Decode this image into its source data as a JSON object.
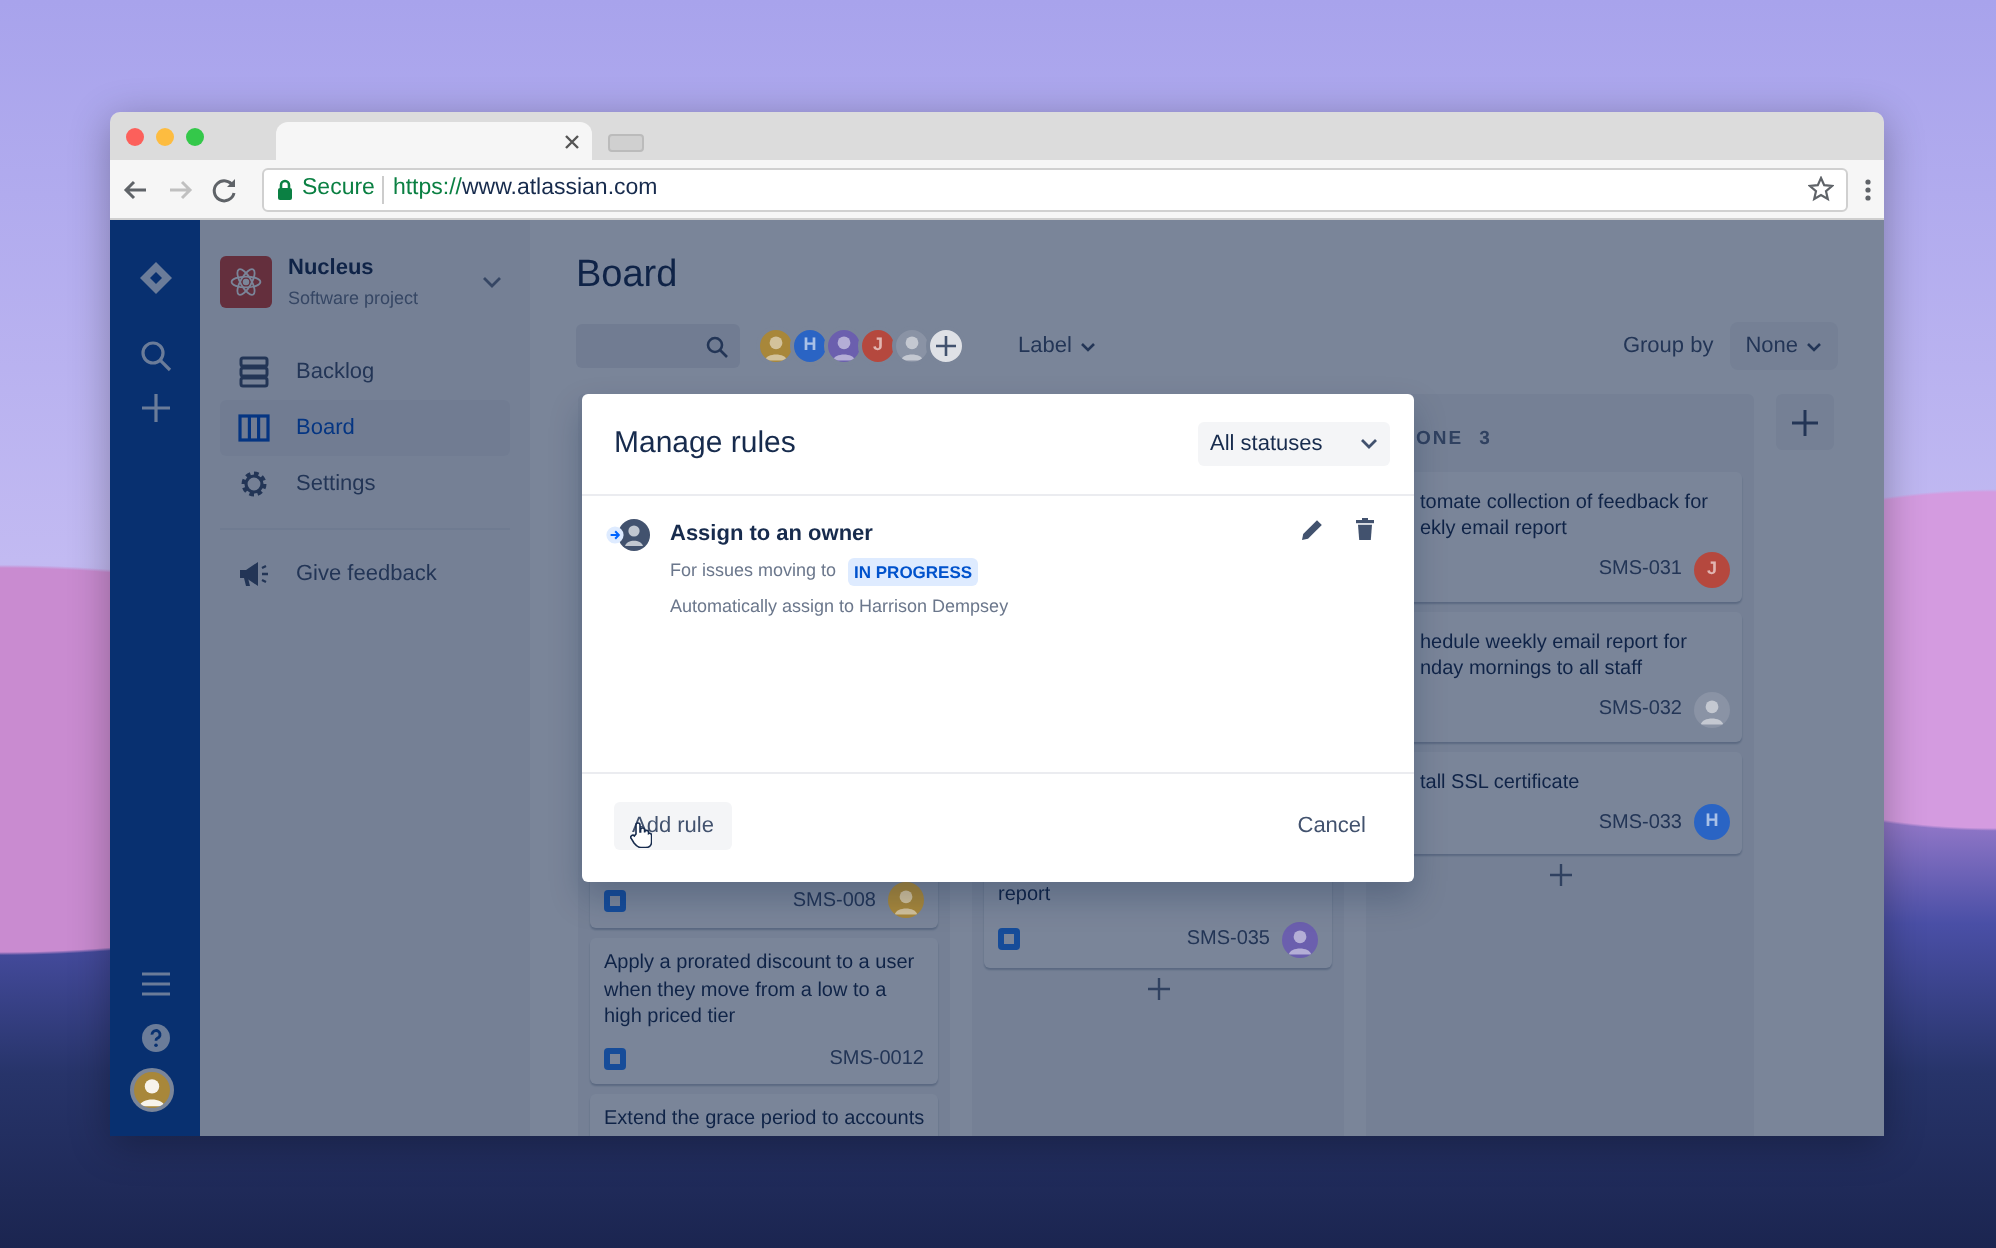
{
  "browser": {
    "back_disabled": false,
    "forward_disabled": true,
    "address": {
      "secure": "Secure",
      "scheme": "https://",
      "host": "www.atlassian.com"
    }
  },
  "project": {
    "name": "Nucleus",
    "type": "Software project"
  },
  "sidebar": {
    "items": [
      {
        "kind": "backlog",
        "label": "Backlog",
        "selected": false
      },
      {
        "kind": "board",
        "label": "Board",
        "selected": true
      },
      {
        "kind": "settings",
        "label": "Settings",
        "selected": false
      }
    ],
    "feedback": "Give feedback"
  },
  "board": {
    "title": "Board",
    "assignees": [
      {
        "kind": "photo",
        "color": "#a8873a"
      },
      {
        "kind": "initial",
        "initial": "H",
        "color": "#2a64c4"
      },
      {
        "kind": "photo",
        "color": "#6b5fae"
      },
      {
        "kind": "initial",
        "initial": "J",
        "color": "#b5483e"
      },
      {
        "kind": "photo",
        "color": "#8a93a5"
      }
    ],
    "label_filter": "Label",
    "group_by": {
      "label": "Group by",
      "value": "None"
    }
  },
  "columns": [
    {
      "cards": [
        {
          "issue_type_icon": true,
          "key": "SMS-008",
          "assignee": {
            "kind": "photo",
            "color": "#a8873a"
          }
        },
        {
          "text": "Apply a prorated discount to a user when they move from a low to a high priced tier",
          "issue_type_icon": true,
          "key": "SMS-0012"
        },
        {
          "text": "Extend the grace period to accounts"
        }
      ]
    },
    {
      "add_button": true,
      "cards": [
        {
          "text": "report",
          "issue_type_icon": true,
          "key": "SMS-035",
          "assignee": {
            "kind": "photo",
            "color": "#6b5fae"
          }
        }
      ]
    },
    {
      "header": {
        "title": "ONE",
        "count": "3"
      },
      "add_button": true,
      "cards": [
        {
          "text": "tomate collection of feedback for\nekly email report",
          "key": "SMS-031",
          "assignee": {
            "kind": "initial",
            "initial": "J",
            "color": "#b5483e"
          }
        },
        {
          "text": "hedule weekly email report for\nnday mornings to all staff",
          "key": "SMS-032",
          "assignee": {
            "kind": "photo",
            "color": "#8a93a5"
          }
        },
        {
          "text": "tall SSL certificate",
          "key": "SMS-033",
          "assignee": {
            "kind": "initial",
            "initial": "H",
            "color": "#2a64c4"
          }
        }
      ]
    }
  ],
  "modal": {
    "title": "Manage rules",
    "status_filter": "All statuses",
    "rules": [
      {
        "title": "Assign to an owner",
        "condition": "For issues moving to",
        "status": "IN PROGRESS",
        "action": "Automatically assign to Harrison Dempsey"
      }
    ],
    "add_button": "Add rule",
    "cancel_button": "Cancel"
  }
}
